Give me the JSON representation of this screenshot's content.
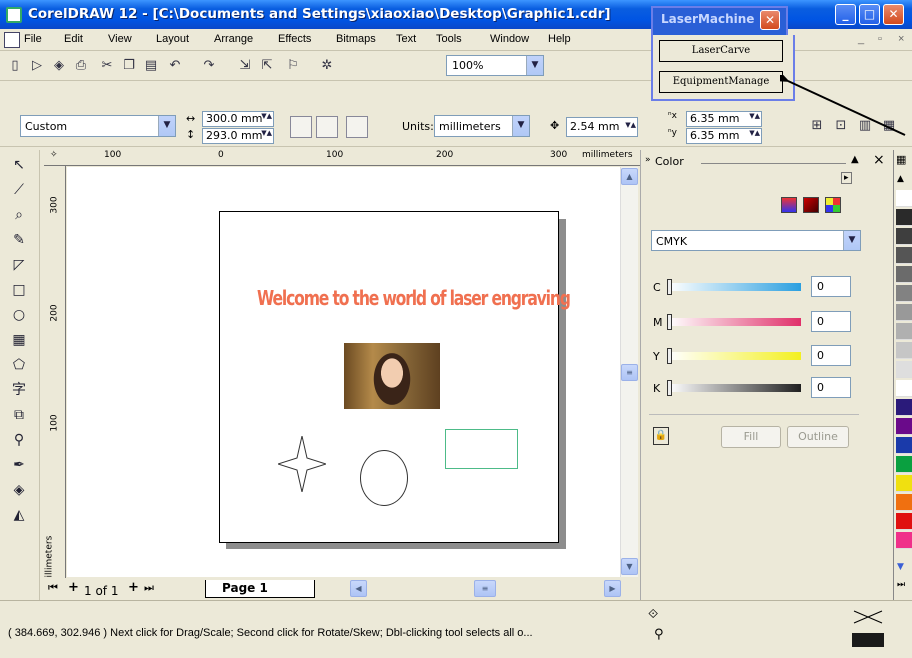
{
  "window": {
    "title": "CorelDRAW 12 - [C:\\Documents and Settings\\xiaoxiao\\Desktop\\Graphic1.cdr]"
  },
  "laser_machine": {
    "title": "LaserMachine",
    "buttons": [
      "LaserCarve",
      "EquipmentManage"
    ]
  },
  "menu": {
    "items": [
      "File",
      "Edit",
      "View",
      "Layout",
      "Arrange",
      "Effects",
      "Bitmaps",
      "Text",
      "Tools",
      "Window",
      "Help"
    ]
  },
  "toolbar": {
    "zoom": "100%"
  },
  "property_bar": {
    "paper_type": "Custom",
    "width": "300.0 mm",
    "height": "293.0 mm",
    "units_label": "Units:",
    "units": "millimeters",
    "nudge": "2.54 mm",
    "dup_x": "6.35 mm",
    "dup_y": "6.35 mm"
  },
  "rulers": {
    "top_ticks": [
      "100",
      "0",
      "100",
      "200",
      "300"
    ],
    "top_unit": "millimeters",
    "left_ticks": [
      "300",
      "200",
      "100"
    ],
    "left_unit": "millimeters"
  },
  "document": {
    "headline": "Welcome to the world of laser engraving"
  },
  "page_nav": {
    "count": "1 of 1",
    "page_tab": "Page 1"
  },
  "color_docker": {
    "title": "Color",
    "model": "CMYK",
    "channels": [
      {
        "label": "C",
        "value": "0",
        "color": "#2a9fe0"
      },
      {
        "label": "M",
        "value": "0",
        "color": "#e0306a"
      },
      {
        "label": "Y",
        "value": "0",
        "color": "#f3f020"
      },
      {
        "label": "K",
        "value": "0",
        "color": "#202020"
      }
    ],
    "fill_label": "Fill",
    "outline_label": "Outline"
  },
  "palette": [
    "#ffffff",
    "#2a2a2a",
    "#3e3e3e",
    "#555555",
    "#6b6b6b",
    "#828282",
    "#999999",
    "#b0b0b0",
    "#c6c6c6",
    "#dedede",
    "#ffffff",
    "#2a1a7a",
    "#6a0a8a",
    "#1a3aaa",
    "#0aa040",
    "#f0e010",
    "#f07010",
    "#e01010",
    "#f0308a"
  ],
  "status": {
    "text": "( 384.669, 302.946 )   Next click for Drag/Scale; Second click for Rotate/Skew; Dbl-clicking tool selects all o..."
  }
}
